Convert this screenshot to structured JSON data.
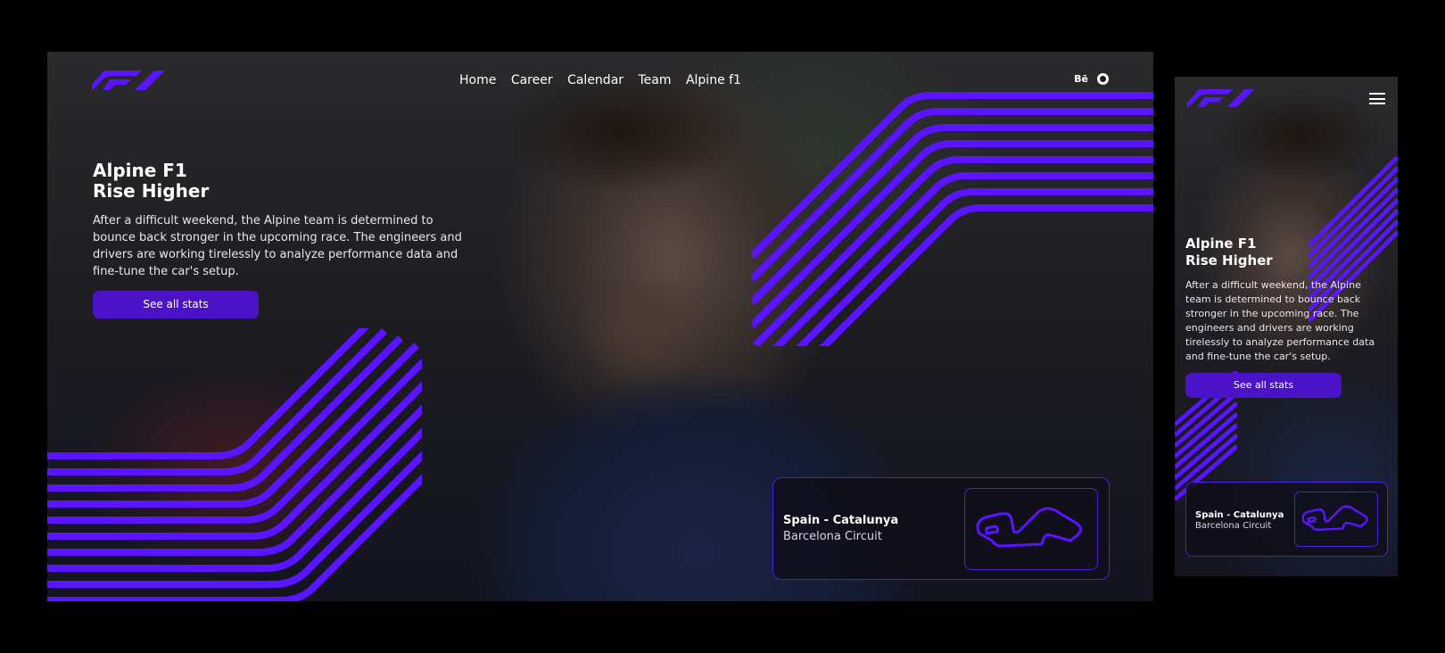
{
  "brand": {
    "logo": "f1-logo",
    "accent": "#4b12c8",
    "stripe": "#5a14ff"
  },
  "nav": {
    "items": [
      {
        "label": "Home"
      },
      {
        "label": "Career"
      },
      {
        "label": "Calendar"
      },
      {
        "label": "Team"
      },
      {
        "label": "Alpine f1"
      }
    ],
    "social": {
      "behance": "Bē",
      "github_icon": "github-icon"
    }
  },
  "hero": {
    "title_line1": "Alpine F1",
    "title_line2": "Rise Higher",
    "body": "After a difficult weekend, the Alpine team is determined to bounce back stronger in the upcoming race. The engineers and drivers are working tirelessly to analyze performance data and fine-tune the car's setup.",
    "button": "See all stats"
  },
  "race_card": {
    "country": "Spain - Catalunya",
    "circuit": "Barcelona Circuit",
    "track_icon": "circuit-track-icon"
  },
  "mobile": {
    "menu_icon": "hamburger-menu-icon"
  }
}
